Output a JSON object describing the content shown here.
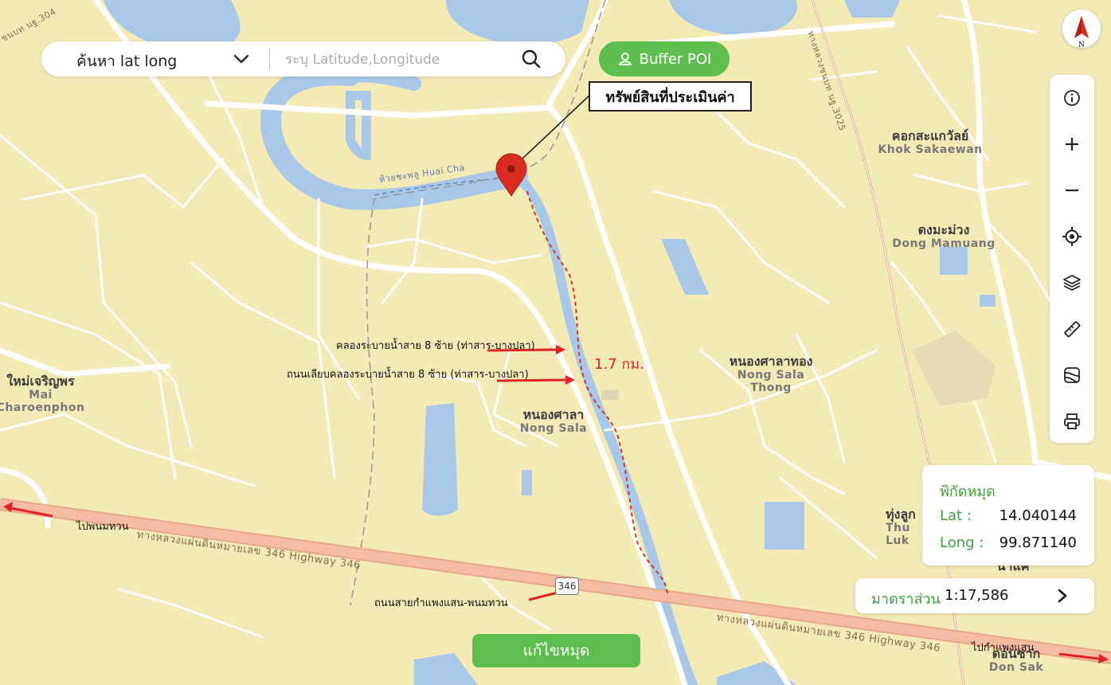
{
  "search": {
    "mode_label": "ค้นหา lat long",
    "placeholder": "ระบุ Latitude,Longitude"
  },
  "buffer_button": {
    "label": "Buffer POI"
  },
  "callout": {
    "label": "ทรัพย์สินที่ประเมินค่า"
  },
  "annotations": {
    "canal": "คลองระบายน้ำสาย 8 ซ้าย (ท่าสาร-บางปลา)",
    "canal_road": "ถนนเลียบคลองระบายน้ำสาย 8 ซ้าย (ท่าสาร-บางปลา)",
    "distance": "1.7 กม.",
    "main_road": "ถนนสายกำแพงแสน-พนมทวน",
    "to_left": "ไปพนมทวน",
    "to_right": "ไปกำแพงแสน"
  },
  "road_labels": {
    "hw346_left": "ทางหลวงแผ่นดินหมายเลข 346 Highway 346",
    "hw346_right": "ทางหลวงแผ่นดินหมายเลข 346 Highway 346",
    "shield": "346",
    "creek": "ห้วยชะพลู Huai Cha",
    "rural_road_ne": "ทางหลวงชนบท นฐ.3025",
    "rural_road_nw": "ชนบท นฐ.304"
  },
  "places": {
    "khok_sakaewan": {
      "th": "คอกสะแกวัลย์",
      "en": "Khok Sakaewan"
    },
    "dong_mamuang": {
      "th": "ดงมะม่วง",
      "en": "Dong Mamuang"
    },
    "nong_sala_thong": {
      "th": "หนองศาลาทอง",
      "en": "Nong Sala",
      "en2": "Thong"
    },
    "nong_sala": {
      "th": "หนองศาลา",
      "en": "Nong Sala"
    },
    "mai_charoenphon": {
      "th": "ใหม่เจริญพร",
      "en": "Mai",
      "en2": "Charoenphon"
    },
    "thung_luk": {
      "th": "ทุ่งลูก",
      "en": "Thu",
      "en2": "Luk"
    },
    "don_sak": {
      "th": "ดอนซาก",
      "en": "Don Sak"
    },
    "partial_na": {
      "th": "นาแค"
    }
  },
  "toolbar": {
    "items": [
      "info-icon",
      "zoom-in-icon",
      "zoom-out-icon",
      "locate-icon",
      "layers-icon",
      "ruler-icon",
      "map-style-icon",
      "print-icon"
    ]
  },
  "coord_panel": {
    "title": "พิกัดหมุด",
    "lat_label": "Lat :",
    "lat_value": "14.040144",
    "long_label": "Long :",
    "long_value": "99.871140"
  },
  "scale": {
    "label": "มาตราส่วน",
    "value": "1:17,586"
  },
  "edit_button": {
    "label": "แก้ไขหมุด"
  },
  "compass": {
    "letter": "N"
  },
  "colors": {
    "land": "#f3eab6",
    "water": "#a9c8e8",
    "road": "#ffffff",
    "highway": "#f0b39a",
    "accent_green": "#5fbf4e",
    "marker": "#d92b1f",
    "annotation_red": "#e02424"
  }
}
